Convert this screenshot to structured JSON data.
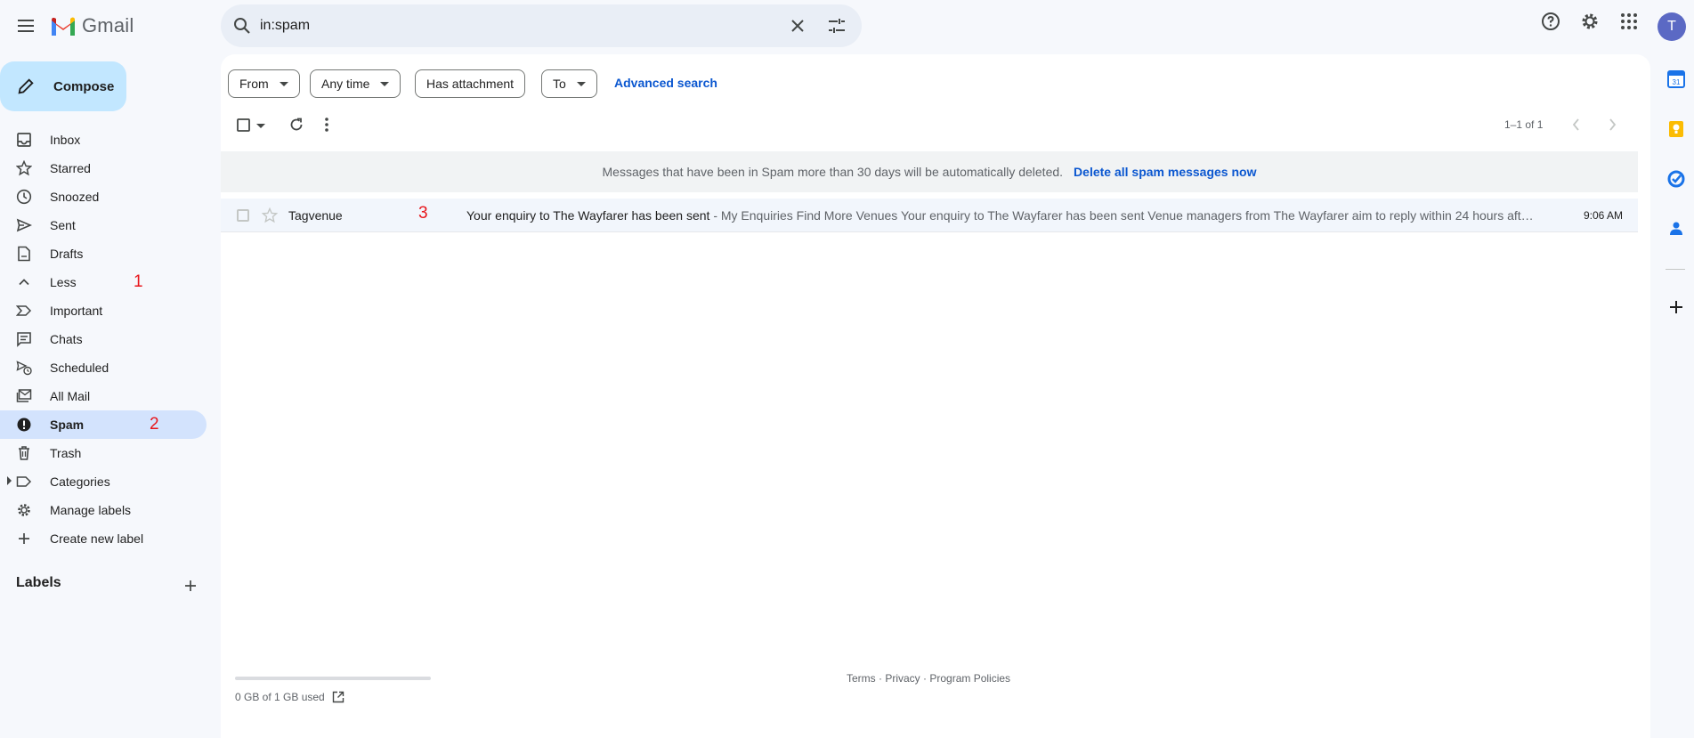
{
  "app": {
    "name": "Gmail",
    "avatar_letter": "T"
  },
  "search": {
    "value": "in:spam"
  },
  "compose": {
    "label": "Compose"
  },
  "sidebar": {
    "items": [
      {
        "label": "Inbox",
        "icon": "inbox-icon"
      },
      {
        "label": "Starred",
        "icon": "star-icon"
      },
      {
        "label": "Snoozed",
        "icon": "clock-icon"
      },
      {
        "label": "Sent",
        "icon": "send-icon"
      },
      {
        "label": "Drafts",
        "icon": "draft-icon"
      },
      {
        "label": "Less",
        "icon": "chevron-up-icon"
      },
      {
        "label": "Important",
        "icon": "important-icon"
      },
      {
        "label": "Chats",
        "icon": "chat-icon"
      },
      {
        "label": "Scheduled",
        "icon": "scheduled-icon"
      },
      {
        "label": "All Mail",
        "icon": "all-mail-icon"
      },
      {
        "label": "Spam",
        "icon": "spam-icon",
        "active": true
      },
      {
        "label": "Trash",
        "icon": "trash-icon"
      },
      {
        "label": "Categories",
        "icon": "label-icon"
      },
      {
        "label": "Manage labels",
        "icon": "gear-icon"
      },
      {
        "label": "Create new label",
        "icon": "plus-icon"
      }
    ],
    "labels_heading": "Labels"
  },
  "markers": {
    "less": "1",
    "spam": "2",
    "row": "3"
  },
  "filters": {
    "from": "From",
    "any_time": "Any time",
    "has_attachment": "Has attachment",
    "to": "To",
    "advanced": "Advanced search"
  },
  "pager": {
    "text": "1–1 of 1"
  },
  "banner": {
    "message": "Messages that have been in Spam more than 30 days will be automatically deleted.",
    "action": "Delete all spam messages now"
  },
  "emails": [
    {
      "sender": "Tagvenue",
      "subject": "Your enquiry to The Wayfarer has been sent",
      "snippet": " - My Enquiries Find More Venues Your enquiry to The Wayfarer has been sent Venue managers from The Wayfarer aim to reply within 24 hours aft…",
      "time": "9:06 AM"
    }
  ],
  "storage": {
    "text": "0 GB of 1 GB used",
    "used_fraction": 0.0
  },
  "footer": {
    "terms": "Terms",
    "sep1": " · ",
    "privacy": "Privacy",
    "sep2": " · ",
    "policies": "Program Policies"
  },
  "colors": {
    "accent": "#0b57d0",
    "compose_bg": "#c2e7ff",
    "active_nav": "#d3e3fd",
    "marker": "#e8161b"
  }
}
